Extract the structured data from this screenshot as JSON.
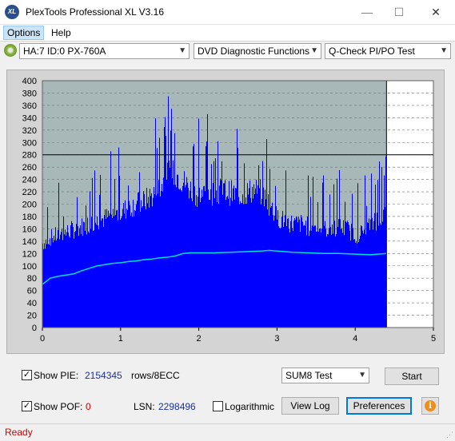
{
  "window": {
    "title": "PlexTools Professional XL V3.16",
    "icon_label": "XL",
    "minimize": "—",
    "maximize": "☐",
    "close": "✕"
  },
  "menu": {
    "items": [
      "Options",
      "Help"
    ]
  },
  "toolbar": {
    "drive": "HA:7 ID:0  PX-760A",
    "function": "DVD Diagnostic Functions",
    "test": "Q-Check PI/PO Test"
  },
  "chart_data": {
    "type": "bar",
    "y_ticks": [
      "400",
      "380",
      "360",
      "340",
      "320",
      "300",
      "280",
      "260",
      "240",
      "220",
      "200",
      "180",
      "160",
      "140",
      "120",
      "100",
      "80",
      "60",
      "40",
      "20",
      "0"
    ],
    "x_ticks": [
      "0",
      "1",
      "2",
      "3",
      "4",
      "5"
    ],
    "ylim": [
      0,
      400
    ],
    "xlim": [
      0,
      5
    ],
    "threshold": 280,
    "data_end_x": 4.4,
    "colors": {
      "bars": "#0000ff",
      "line": "#00e0e0",
      "plot_bg": "#a8b8b8",
      "empty_bg": "#ffffff",
      "threshold": "#000000"
    },
    "pie_envelope": [
      [
        0.0,
        150
      ],
      [
        0.1,
        160
      ],
      [
        0.2,
        165
      ],
      [
        0.3,
        170
      ],
      [
        0.4,
        175
      ],
      [
        0.5,
        180
      ],
      [
        0.6,
        185
      ],
      [
        0.7,
        190
      ],
      [
        0.8,
        195
      ],
      [
        0.9,
        200
      ],
      [
        1.0,
        205
      ],
      [
        1.1,
        215
      ],
      [
        1.2,
        220
      ],
      [
        1.3,
        225
      ],
      [
        1.4,
        235
      ],
      [
        1.5,
        250
      ],
      [
        1.6,
        270
      ],
      [
        1.7,
        275
      ],
      [
        1.8,
        260
      ],
      [
        1.9,
        245
      ],
      [
        2.0,
        235
      ],
      [
        2.1,
        240
      ],
      [
        2.2,
        240
      ],
      [
        2.3,
        245
      ],
      [
        2.4,
        240
      ],
      [
        2.5,
        235
      ],
      [
        2.6,
        240
      ],
      [
        2.7,
        245
      ],
      [
        2.8,
        240
      ],
      [
        2.9,
        220
      ],
      [
        3.0,
        195
      ],
      [
        3.1,
        190
      ],
      [
        3.2,
        185
      ],
      [
        3.3,
        185
      ],
      [
        3.4,
        180
      ],
      [
        3.5,
        180
      ],
      [
        3.6,
        175
      ],
      [
        3.7,
        178
      ],
      [
        3.8,
        180
      ],
      [
        3.9,
        175
      ],
      [
        4.0,
        165
      ],
      [
        4.1,
        170
      ],
      [
        4.2,
        185
      ],
      [
        4.3,
        195
      ],
      [
        4.4,
        200
      ]
    ],
    "avg_line": [
      [
        0.0,
        70
      ],
      [
        0.1,
        80
      ],
      [
        0.2,
        83
      ],
      [
        0.3,
        85
      ],
      [
        0.4,
        87
      ],
      [
        0.5,
        92
      ],
      [
        0.6,
        96
      ],
      [
        0.7,
        100
      ],
      [
        0.8,
        102
      ],
      [
        0.9,
        104
      ],
      [
        1.0,
        105
      ],
      [
        1.1,
        107
      ],
      [
        1.2,
        108
      ],
      [
        1.3,
        110
      ],
      [
        1.4,
        111
      ],
      [
        1.5,
        113
      ],
      [
        1.6,
        114
      ],
      [
        1.7,
        116
      ],
      [
        1.8,
        120
      ],
      [
        1.9,
        121
      ],
      [
        2.0,
        121
      ],
      [
        2.2,
        121
      ],
      [
        2.4,
        122
      ],
      [
        2.6,
        123
      ],
      [
        2.8,
        124
      ],
      [
        2.9,
        125
      ],
      [
        3.0,
        124
      ],
      [
        3.2,
        122
      ],
      [
        3.4,
        121
      ],
      [
        3.6,
        120
      ],
      [
        3.8,
        120
      ],
      [
        4.0,
        119
      ],
      [
        4.2,
        118
      ],
      [
        4.4,
        120
      ]
    ]
  },
  "controls": {
    "show_pie_label": "Show PIE:",
    "show_pie_checked": "✓",
    "pie_value": "2154345",
    "rows_label": "rows/8ECC",
    "show_pof_label": "Show POF:",
    "show_pof_checked": "✓",
    "pof_value": "0",
    "lsn_label": "LSN:",
    "lsn_value": "2298496",
    "log_label": "Logarithmic",
    "sum8": "SUM8 Test",
    "start": "Start",
    "view_log": "View Log",
    "preferences": "Preferences",
    "info": "i"
  },
  "status": {
    "text": "Ready",
    "grip": "⋰"
  }
}
